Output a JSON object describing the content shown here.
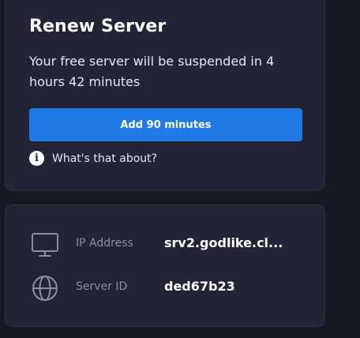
{
  "renew": {
    "title": "Renew Server",
    "message": "Your free server will be suspended in 4 hours 42 minutes",
    "button_label": "Add 90 minutes",
    "help_text": "What's that about?",
    "help_icon": "info-icon",
    "button_color": "#1f7ae6"
  },
  "server_info": {
    "ip": {
      "icon": "monitor-icon",
      "label": "IP Address",
      "value": "srv2.godlike.cl..."
    },
    "server_id": {
      "icon": "globe-icon",
      "label": "Server ID",
      "value": "ded67b23"
    }
  },
  "colors": {
    "background": "#181822",
    "card": "#242436",
    "accent": "#1f7ae6",
    "muted_text": "#8b8ba3"
  }
}
